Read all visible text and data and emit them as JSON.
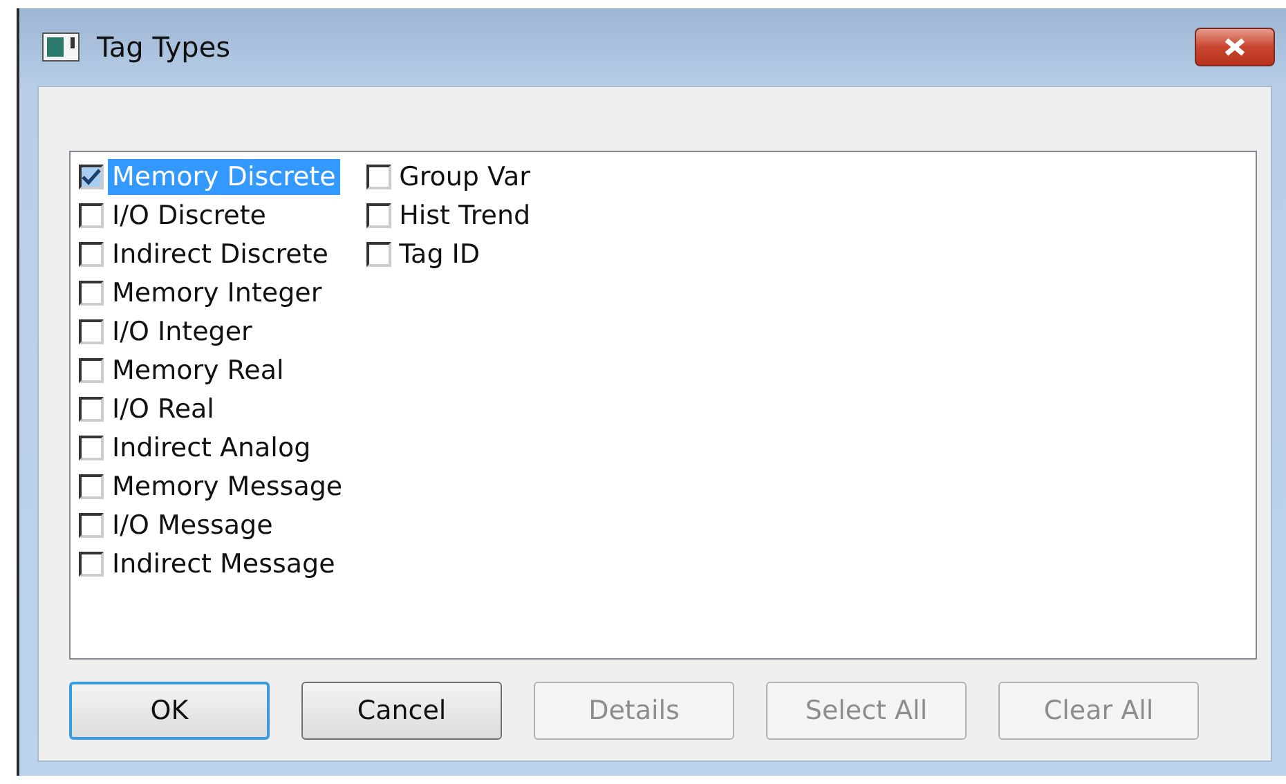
{
  "window": {
    "title": "Tag Types"
  },
  "items": [
    {
      "label": "Memory Discrete",
      "checked": true,
      "selected": true
    },
    {
      "label": "I/O Discrete",
      "checked": false,
      "selected": false
    },
    {
      "label": "Indirect Discrete",
      "checked": false,
      "selected": false
    },
    {
      "label": "Memory Integer",
      "checked": false,
      "selected": false
    },
    {
      "label": "I/O Integer",
      "checked": false,
      "selected": false
    },
    {
      "label": "Memory Real",
      "checked": false,
      "selected": false
    },
    {
      "label": "I/O Real",
      "checked": false,
      "selected": false
    },
    {
      "label": "Indirect Analog",
      "checked": false,
      "selected": false
    },
    {
      "label": "Memory Message",
      "checked": false,
      "selected": false
    },
    {
      "label": "I/O Message",
      "checked": false,
      "selected": false
    },
    {
      "label": "Indirect Message",
      "checked": false,
      "selected": false
    },
    {
      "label": "Group Var",
      "checked": false,
      "selected": false
    },
    {
      "label": "Hist Trend",
      "checked": false,
      "selected": false
    },
    {
      "label": "Tag ID",
      "checked": false,
      "selected": false
    }
  ],
  "buttons": [
    {
      "label": "OK",
      "default": true,
      "disabled": false
    },
    {
      "label": "Cancel",
      "default": false,
      "disabled": false
    },
    {
      "label": "Details",
      "default": false,
      "disabled": true
    },
    {
      "label": "Select All",
      "default": false,
      "disabled": true
    },
    {
      "label": "Clear All",
      "default": false,
      "disabled": true
    }
  ]
}
